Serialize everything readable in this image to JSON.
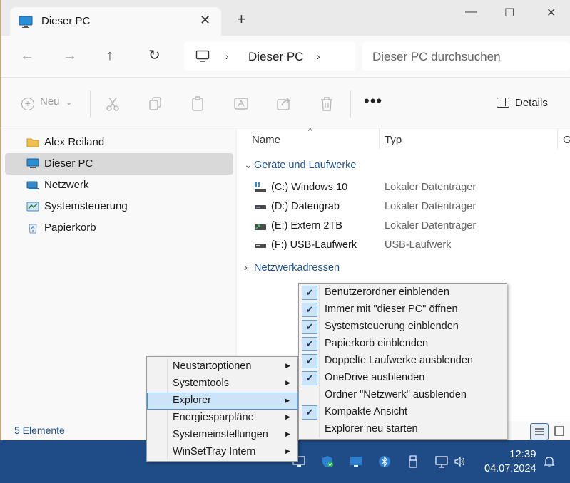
{
  "window": {
    "tab_title": "Dieser PC",
    "tab_close": "✕",
    "new_tab": "+",
    "minimize": "—",
    "maximize": "☐",
    "close": "✕"
  },
  "nav": {
    "back": "←",
    "forward": "→",
    "up": "↑",
    "refresh": "↻",
    "breadcrumb": "Dieser PC",
    "chevron": "›",
    "search_placeholder": "Dieser PC durchsuchen"
  },
  "toolbar": {
    "new_label": "Neu",
    "new_chevron": "⌄",
    "more": "•••",
    "details_label": "Details"
  },
  "sidebar": {
    "items": [
      {
        "label": "Alex Reiland",
        "icon": "folder-icon",
        "color": "#f0c24b"
      },
      {
        "label": "Dieser PC",
        "icon": "computer-icon",
        "color": "#2b8fd6",
        "selected": true
      },
      {
        "label": "Netzwerk",
        "icon": "network-icon",
        "color": "#3a88c9"
      },
      {
        "label": "Systemsteuerung",
        "icon": "control-panel-icon",
        "color": "#3a88c9"
      },
      {
        "label": "Papierkorb",
        "icon": "recycle-bin-icon",
        "color": "#3a88c9"
      }
    ]
  },
  "content": {
    "columns": [
      "Name",
      "Typ",
      "Gr"
    ],
    "sort_caret": "^",
    "groups": {
      "drives_title": "Geräte und Laufwerke",
      "drives_chevron": "⌄",
      "network_title": "Netzwerkadressen",
      "network_chevron": "›"
    },
    "drives": [
      {
        "name": "(C:) Windows 10",
        "type": "Lokaler Datenträger"
      },
      {
        "name": "(D:) Datengrab",
        "type": "Lokaler Datenträger"
      },
      {
        "name": "(E:) Extern 2TB",
        "type": "Lokaler Datenträger"
      },
      {
        "name": "(F:) USB-Laufwerk",
        "type": "USB-Laufwerk"
      }
    ]
  },
  "status": {
    "items_count": "5 Elemente"
  },
  "taskbar": {
    "time": "12:39",
    "date": "04.07.2024"
  },
  "main_menu": {
    "arrow": "▶",
    "items": [
      {
        "label": "Neustartoptionen"
      },
      {
        "label": "Systemtools"
      },
      {
        "label": "Explorer",
        "highlighted": true
      },
      {
        "label": "Energiesparpläne"
      },
      {
        "label": "Systemeinstellungen"
      },
      {
        "label": "WinSetTray Intern"
      }
    ]
  },
  "sub_menu": {
    "check_glyph": "✔",
    "items": [
      {
        "label": "Benutzerordner einblenden",
        "checked": true
      },
      {
        "label": "Immer mit \"dieser PC\" öffnen",
        "checked": true
      },
      {
        "label": "Systemsteuerung einblenden",
        "checked": true
      },
      {
        "label": "Papierkorb einblenden",
        "checked": true
      },
      {
        "label": "Doppelte Laufwerke ausblenden",
        "checked": true
      },
      {
        "label": "OneDrive ausblenden",
        "checked": true
      },
      {
        "label": "Ordner \"Netzwerk\" ausblenden",
        "checked": false
      },
      {
        "label": "Kompakte Ansicht",
        "checked": true
      },
      {
        "label": "Explorer neu starten",
        "checked": false
      }
    ]
  },
  "colors": {
    "accent": "#1f4f8a",
    "taskbar": "#1f4b86",
    "menu_highlight": "#cce4f7"
  }
}
